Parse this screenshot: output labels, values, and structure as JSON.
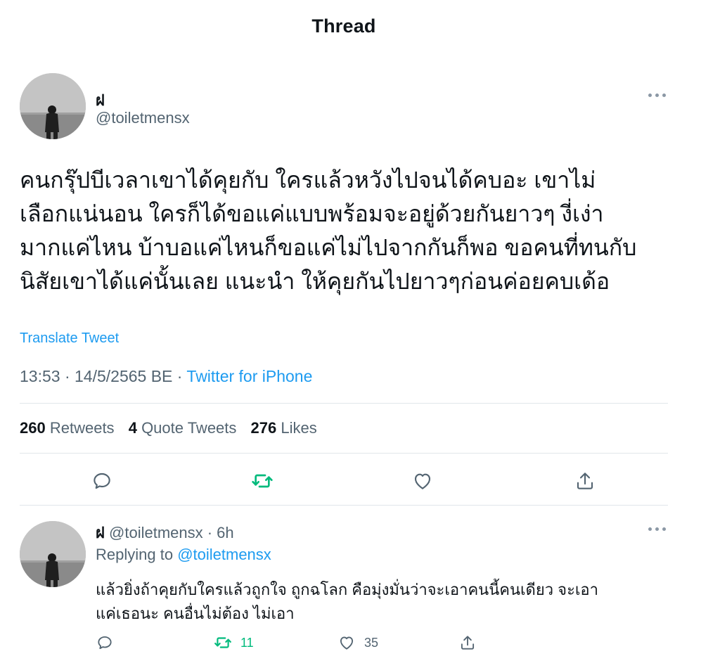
{
  "header": {
    "title": "Thread"
  },
  "tweet": {
    "author": {
      "name": "ฝ",
      "handle": "@toiletmensx"
    },
    "text_lines": [
      "คนกรุ๊ปบีเวลาเขาได้คุยกับ ใครแล้วหวังไปจนได้คบอะ เขาไม่",
      "เลือกแน่นอน  ใครก็ได้ขอแค่แบบพร้อมจะอยู่ด้วยกันยาวๆ งี่เง่า",
      "มากแค่ไหน บ้าบอแค่ไหนก็ขอแค่ไม่ไปจากกันก็พอ ขอคนที่ทนกับ",
      "นิสัยเขาได้แค่นั้นเลย แนะนำ ให้คุยกันไปยาวๆก่อนค่อยคบเด้อ"
    ],
    "translate_label": "Translate Tweet",
    "timestamp": "13:53 · 14/5/2565 BE · ",
    "source": "Twitter for iPhone",
    "stats": {
      "retweets_count": "260",
      "retweets_label": "Retweets",
      "quotes_count": "4",
      "quotes_label": "Quote Tweets",
      "likes_count": "276",
      "likes_label": "Likes"
    }
  },
  "reply": {
    "author": {
      "name": "ฝ",
      "handle": "@toiletmensx",
      "time": " · 6h"
    },
    "replying_prefix": "Replying to ",
    "replying_to": "@toiletmensx",
    "text_lines": [
      "แล้วยิ่งถ้าคุยกับใครแล้วถูกใจ ถูกฉโลก คือมุ่งมั่นว่าจะเอาคนนี้คนเดียว จะเอา",
      "แค่เธอนะ คนอื่นไม่ต้อง ไม่เอา"
    ],
    "actions": {
      "reply_count": "",
      "retweet_count": "11",
      "like_count": "35"
    }
  },
  "colors": {
    "accent": "#1d9bf0",
    "retweet_green": "#00ba7c",
    "secondary_text": "#536471",
    "primary_text": "#0f1419",
    "divider": "#e1e6ea"
  },
  "icons": {
    "more": "more-horizontal-icon",
    "reply": "speech-bubble-icon",
    "retweet": "retweet-arrows-icon",
    "like": "heart-icon",
    "share": "share-upload-icon"
  }
}
